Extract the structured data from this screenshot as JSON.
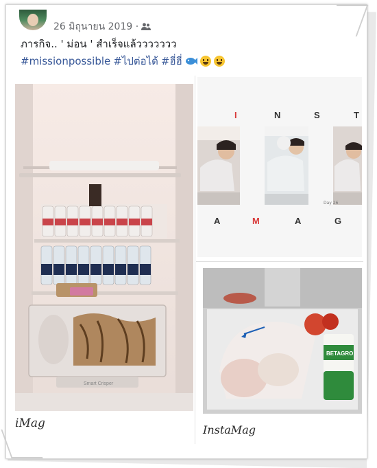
{
  "post": {
    "date": "26 มิถุนายน 2019 ·",
    "text_line1": "ภารกิจ.. ' ม่อน ' สำเร็จแล้ววววววว",
    "hashtags": [
      "#missionpossible",
      "#ไปต่อได้",
      "#ฮี่ฮี่"
    ],
    "emoji": [
      "fish-icon",
      "grin-emoji",
      "smile-emoji"
    ]
  },
  "photos": {
    "left_caption": "iMag",
    "right_caption": "InstaMag",
    "insta_letters_top": [
      "I",
      "N",
      "S",
      "T"
    ],
    "insta_letters_bottom": [
      "A",
      "M",
      "A",
      "G"
    ],
    "insta_date_mark": "Day 26",
    "freezer_label": "BETAGRO",
    "fridge_drawer_label": "Smart Crisper"
  },
  "colors": {
    "link_blue": "#385898",
    "insta_red": "#d93b3b",
    "meta_gray": "#65676b"
  }
}
